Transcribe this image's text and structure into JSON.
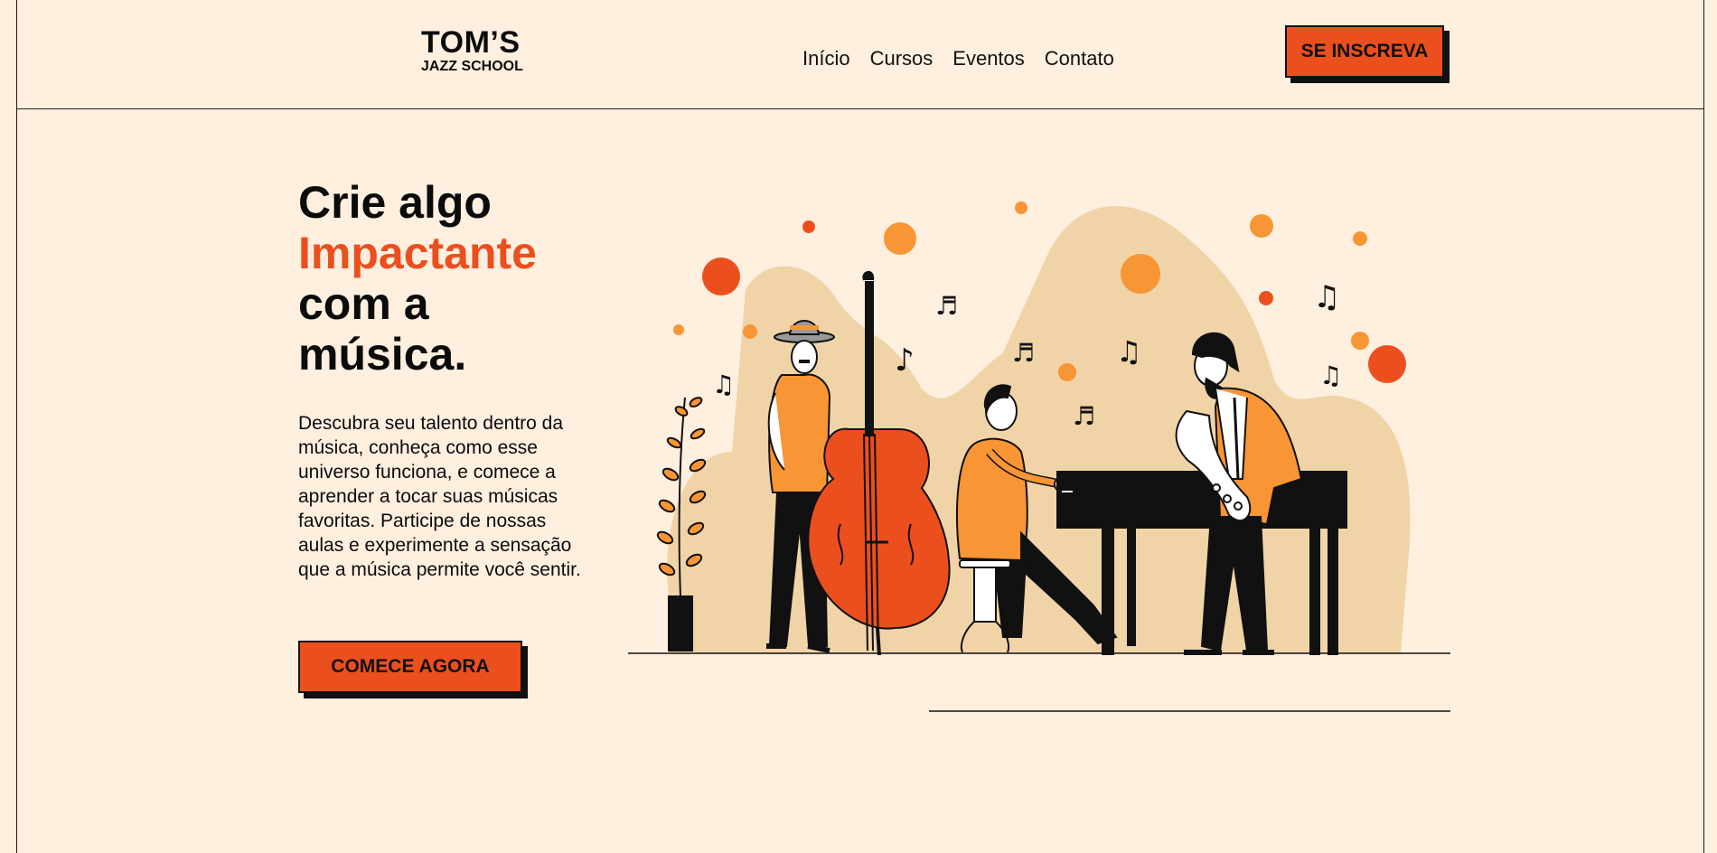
{
  "header": {
    "logo_main": "TOM’S",
    "logo_sub": "JAZZ SCHOOL",
    "nav": [
      "Início",
      "Cursos",
      "Eventos",
      "Contato"
    ],
    "cta_label": "SE INSCREVA"
  },
  "hero": {
    "title_line1": "Crie algo",
    "title_accent": "Impactante",
    "title_line3": "com a",
    "title_line4": "música.",
    "description": "Descubra seu talento dentro da música, conheça como esse universo funciona, e comece a aprender a tocar suas músicas favoritas. Participe de nossas aulas e experimente a sensação que a música permite você sentir.",
    "cta_label": "COMECE AGORA"
  },
  "illustration": {
    "name": "jazz-band-illustration",
    "icons": [
      "bassist",
      "pianist",
      "saxophonist",
      "plant",
      "music-note-icon"
    ]
  },
  "colors": {
    "background": "#ffefdf",
    "accent": "#ec4f1e",
    "orange": "#f89535",
    "blob": "#f0d4a8",
    "text": "#0b0b0b"
  }
}
